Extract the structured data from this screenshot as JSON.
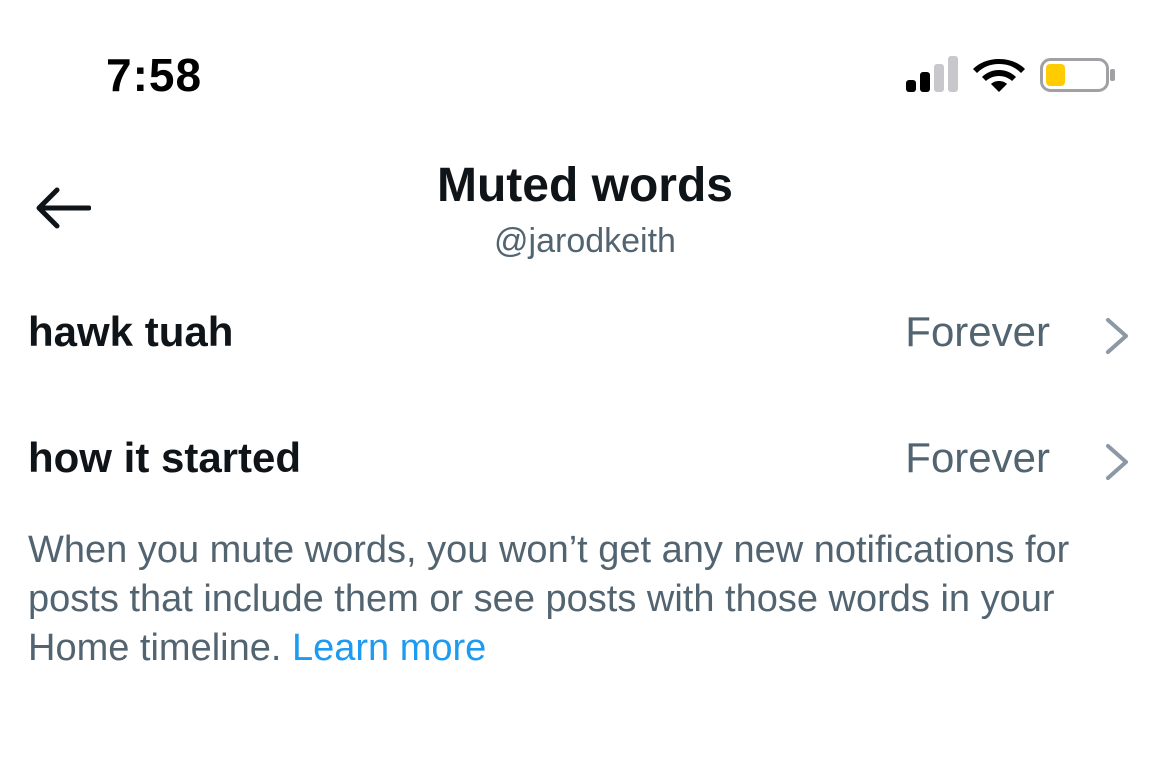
{
  "status_bar": {
    "time": "7:58",
    "signal_icon": "cellular-signal-icon",
    "wifi_icon": "wifi-icon",
    "battery_icon": "battery-low-icon",
    "battery_color": "#ffcc00"
  },
  "header": {
    "back_icon": "arrow-left-icon",
    "title": "Muted words",
    "subtitle": "@jarodkeith"
  },
  "muted_words": [
    {
      "word": "hawk tuah",
      "duration": "Forever"
    },
    {
      "word": "how it started",
      "duration": "Forever"
    }
  ],
  "info": {
    "text": "When you mute words, you won’t get any new notifications for posts that include them or see posts with those words in your Home timeline. ",
    "link": "Learn more"
  },
  "colors": {
    "text_primary": "#0f1419",
    "text_secondary": "#536471",
    "link": "#1d9bf0",
    "chevron": "#8b98a5"
  }
}
